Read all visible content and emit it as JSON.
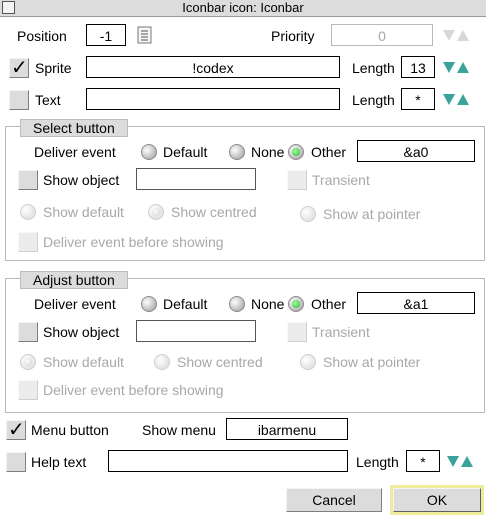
{
  "window": {
    "title": "Iconbar icon: Iconbar"
  },
  "position": {
    "label": "Position",
    "value": "-1"
  },
  "priority": {
    "label": "Priority",
    "value": "0"
  },
  "sprite": {
    "label": "Sprite",
    "checked": true,
    "value": "!codex",
    "length_label": "Length",
    "length": "13"
  },
  "text": {
    "label": "Text",
    "checked": false,
    "value": "",
    "length_label": "Length",
    "length": "*"
  },
  "select_button": {
    "title": "Select button",
    "deliver_event": "Deliver event",
    "default": "Default",
    "none": "None",
    "other": "Other",
    "other_value": "&a0",
    "show_object": "Show object",
    "show_object_value": "",
    "transient": "Transient",
    "show_default": "Show default",
    "show_centred": "Show centred",
    "show_at_pointer": "Show at pointer",
    "deliver_before": "Deliver event before showing"
  },
  "adjust_button": {
    "title": "Adjust button",
    "deliver_event": "Deliver event",
    "default": "Default",
    "none": "None",
    "other": "Other",
    "other_value": "&a1",
    "show_object": "Show object",
    "show_object_value": "",
    "transient": "Transient",
    "show_default": "Show default",
    "show_centred": "Show centred",
    "show_at_pointer": "Show at pointer",
    "deliver_before": "Deliver event before showing"
  },
  "menu": {
    "label": "Menu button",
    "checked": true,
    "show_menu_label": "Show menu",
    "value": "ibarmenu"
  },
  "help": {
    "label": "Help text",
    "checked": false,
    "value": "",
    "length_label": "Length",
    "length": "*"
  },
  "actions": {
    "cancel": "Cancel",
    "ok": "OK"
  },
  "colors": {
    "radio_on": "#2eb62e",
    "arrow": "#3aa39a",
    "ok_highlight": "#ecec9c",
    "panel": "#dcdcdc"
  }
}
